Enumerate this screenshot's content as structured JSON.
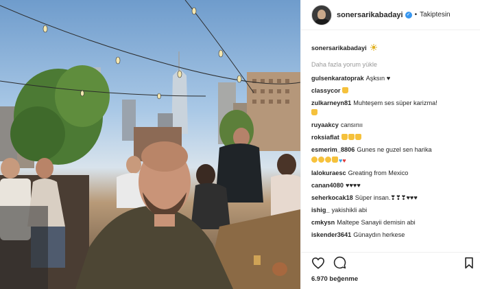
{
  "post": {
    "username": "sonersarikabadayi",
    "follow_label": "Takiptesin",
    "caption_username": "sonersarikabadayi",
    "caption_emoji": "sun-emoji",
    "load_more": "Daha fazla yorum yükle",
    "likes": "6.970 beğenme"
  },
  "comments": [
    {
      "user": "gulsenkaratoprak",
      "text": "Aşksın ♥"
    },
    {
      "user": "classycor",
      "text": ""
    },
    {
      "user": "zulkarneyn81",
      "text": "Muhteşem ses süper karizma!"
    },
    {
      "user": "ruyaakcy",
      "text": "cansınıı"
    },
    {
      "user": "roksiaflat",
      "text": ""
    },
    {
      "user": "esmerim_8806",
      "text": "Gunes ne guzel sen harika"
    },
    {
      "user": "lalokuraesc",
      "text": "Greating from Mexico"
    },
    {
      "user": "canan4080",
      "text": "♥♥♥♥"
    },
    {
      "user": "seherkocak18",
      "text": "Süper insan.❣❣❣♥♥♥"
    },
    {
      "user": "ishig_",
      "text": "yakishikli abi"
    },
    {
      "user": "cmkysn",
      "text": "Maltepe Sanayii demisin abi"
    },
    {
      "user": "iskender3641",
      "text": "Günaydın herkese"
    }
  ],
  "icons": {
    "heart": "heart-icon",
    "comment": "comment-icon",
    "bookmark": "bookmark-icon",
    "verified": "verified-badge-icon"
  },
  "colors": {
    "verified": "#3897f0",
    "muted": "#999999",
    "text": "#262626"
  }
}
